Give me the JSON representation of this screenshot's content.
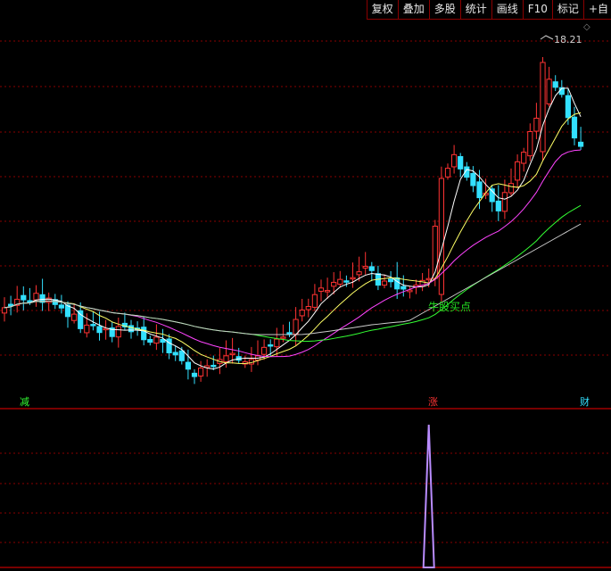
{
  "toolbar": {
    "items": [
      "复权",
      "叠加",
      "多股",
      "统计",
      "画线",
      "F10",
      "标记",
      "+自"
    ]
  },
  "chart": {
    "peak_label": "18.21",
    "buy_signal_label": "牛股买点",
    "flags": {
      "reduce": "减",
      "rise": "涨",
      "finance": "财"
    },
    "diamond_icon": "diamond-outline-icon",
    "colors": {
      "up": "#ff3333",
      "down": "#33e0ff",
      "ma5": "#ffffff",
      "ma10": "#ffff66",
      "ma20": "#ff44ff",
      "ma60": "#33ff33",
      "ma120": "#cccccc",
      "grid": "#8a0000",
      "signal": "#b98cff"
    }
  },
  "chart_data": {
    "type": "candlestick",
    "peak_price": 18.21,
    "buy_signal_index": 67,
    "flags": [
      "减",
      "涨",
      "财"
    ],
    "indicator_signal_at_index": 67
  }
}
